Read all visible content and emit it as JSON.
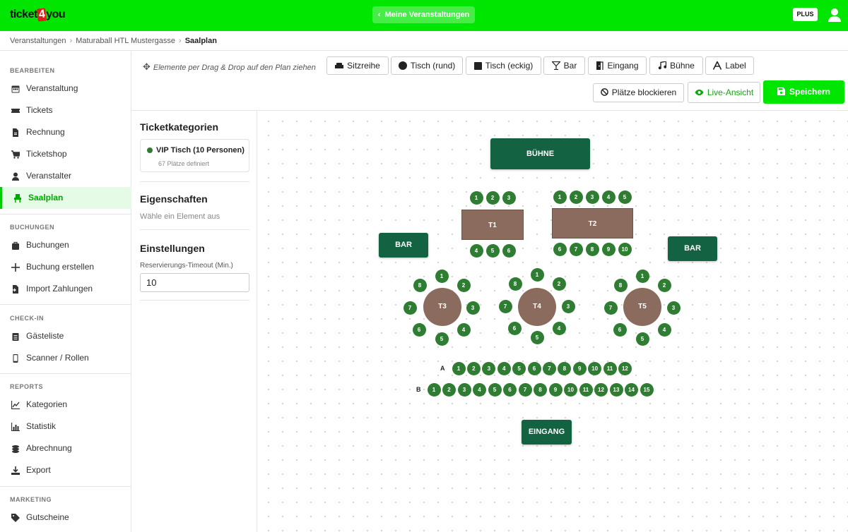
{
  "header": {
    "logo": {
      "pre": "ticket",
      "num": "4",
      "post": "you"
    },
    "back_button": "Meine Veranstaltungen",
    "badge": "PLUS",
    "brand_color": "#00e600"
  },
  "breadcrumb": {
    "items": [
      "Veranstaltungen",
      "Maturaball HTL Mustergasse",
      "Saalplan"
    ]
  },
  "sidebar": {
    "sections": [
      {
        "title": "BEARBEITEN",
        "items": [
          {
            "label": "Veranstaltung",
            "icon": "calendar-icon"
          },
          {
            "label": "Tickets",
            "icon": "ticket-icon"
          },
          {
            "label": "Rechnung",
            "icon": "invoice-icon"
          },
          {
            "label": "Ticketshop",
            "icon": "cart-icon"
          },
          {
            "label": "Veranstalter",
            "icon": "user-icon"
          },
          {
            "label": "Saalplan",
            "icon": "seat-icon",
            "active": true
          }
        ]
      },
      {
        "title": "BUCHUNGEN",
        "items": [
          {
            "label": "Buchungen",
            "icon": "bag-icon"
          },
          {
            "label": "Buchung erstellen",
            "icon": "plus-icon"
          },
          {
            "label": "Import Zahlungen",
            "icon": "file-import-icon"
          }
        ]
      },
      {
        "title": "CHECK-IN",
        "items": [
          {
            "label": "Gästeliste",
            "icon": "clipboard-icon"
          },
          {
            "label": "Scanner / Rollen",
            "icon": "mobile-icon"
          }
        ]
      },
      {
        "title": "REPORTS",
        "items": [
          {
            "label": "Kategorien",
            "icon": "line-chart-icon"
          },
          {
            "label": "Statistik",
            "icon": "bar-chart-icon"
          },
          {
            "label": "Abrechnung",
            "icon": "coins-icon"
          },
          {
            "label": "Export",
            "icon": "download-icon"
          }
        ]
      },
      {
        "title": "MARKETING",
        "items": [
          {
            "label": "Gutscheine",
            "icon": "tag-icon"
          }
        ]
      }
    ]
  },
  "toolbar": {
    "hint": "Elemente per Drag & Drop auf den Plan ziehen",
    "tools": [
      {
        "label": "Sitzreihe",
        "icon": "sofa-icon"
      },
      {
        "label": "Tisch (rund)",
        "icon": "circle-icon"
      },
      {
        "label": "Tisch (eckig)",
        "icon": "square-icon"
      },
      {
        "label": "Bar",
        "icon": "cocktail-icon"
      },
      {
        "label": "Eingang",
        "icon": "door-icon"
      },
      {
        "label": "Bühne",
        "icon": "music-icon"
      },
      {
        "label": "Label",
        "icon": "font-icon"
      }
    ],
    "block_seats": "Plätze blockieren",
    "live_view": "Live-Ansicht",
    "save": "Speichern"
  },
  "panel": {
    "categories_title": "Ticketkategorien",
    "category": {
      "name": "VIP Tisch (10 Personen)",
      "sub": "67 Plätze definiert",
      "color": "#2e7d32"
    },
    "properties_title": "Eigenschaften",
    "properties_hint": "Wähle ein Element aus",
    "settings_title": "Einstellungen",
    "timeout_label": "Reservierungs-Timeout (Min.)",
    "timeout_value": "10"
  },
  "plan": {
    "stage_label": "BÜHNE",
    "bar_left_label": "BAR",
    "bar_right_label": "BAR",
    "entrance_label": "EINGANG",
    "tables": {
      "T1": {
        "label": "T1",
        "top_seats": [
          "1",
          "2",
          "3"
        ],
        "bottom_seats": [
          "4",
          "5",
          "6"
        ]
      },
      "T2": {
        "label": "T2",
        "top_seats": [
          "1",
          "2",
          "3",
          "4",
          "5"
        ],
        "bottom_seats": [
          "6",
          "7",
          "8",
          "9",
          "10"
        ]
      },
      "T3": {
        "label": "T3",
        "seats": [
          "1",
          "2",
          "3",
          "4",
          "5",
          "6",
          "7",
          "8"
        ]
      },
      "T4": {
        "label": "T4",
        "seats": [
          "1",
          "2",
          "3",
          "4",
          "5",
          "6",
          "7",
          "8"
        ]
      },
      "T5": {
        "label": "T5",
        "seats": [
          "1",
          "2",
          "3",
          "4",
          "5",
          "6",
          "7",
          "8"
        ]
      }
    },
    "rows": [
      {
        "label": "A",
        "seats": [
          "1",
          "2",
          "3",
          "4",
          "5",
          "6",
          "7",
          "8",
          "9",
          "10",
          "11",
          "12"
        ]
      },
      {
        "label": "B",
        "seats": [
          "1",
          "2",
          "3",
          "4",
          "5",
          "6",
          "7",
          "8",
          "9",
          "10",
          "11",
          "12",
          "13",
          "14",
          "15"
        ]
      }
    ],
    "colors": {
      "element": "#136241",
      "table": "#8b6b5e",
      "seat": "#2e7d32"
    }
  }
}
